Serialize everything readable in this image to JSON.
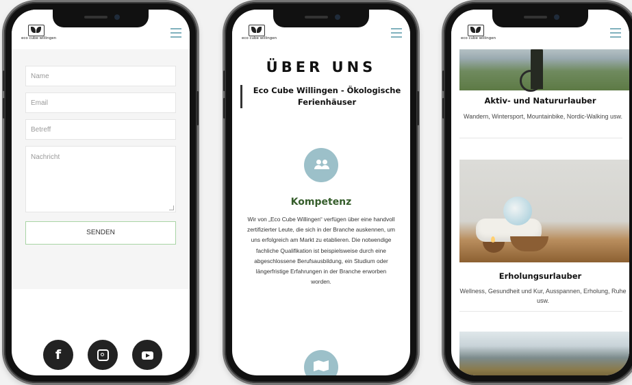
{
  "logo_text": "eco cube willingen",
  "phone1": {
    "fields": {
      "name_placeholder": "Name",
      "email_placeholder": "Email",
      "subject_placeholder": "Betreff",
      "message_placeholder": "Nachricht"
    },
    "send_label": "SENDEN",
    "social": [
      "facebook-icon",
      "instagram-icon",
      "youtube-icon"
    ],
    "facebook_glyph": "f"
  },
  "phone2": {
    "title": "ÜBER UNS",
    "subtitle": "Eco Cube Willingen - Ökologische Ferienhäuser",
    "section_title": "Kompetenz",
    "section_text": "Wir von „Eco Cube Willingen“ verfügen über eine handvoll zertifizierter Leute, die sich in der Branche auskennen, um uns erfolgreich am Markt zu etablieren. Die notwendige fachliche Qualifikation ist beispielsweise durch eine abgeschlossene Berufsausbildung, ein Studium oder längerfristige Erfahrungen in der Branche erworben worden."
  },
  "phone3": {
    "cards": [
      {
        "title": "Aktiv- und Natururlauber",
        "text": "Wandern, Wintersport, Mountainbike, Nordic-Walking usw."
      },
      {
        "title": "Erholungsurlauber",
        "text": "Wellness, Gesundheit und Kur, Ausspannen, Erholung, Ruhe usw."
      }
    ]
  },
  "colors": {
    "accent": "#9cc0c9",
    "heading_green": "#355d2b",
    "menu": "#7fb1bd"
  }
}
